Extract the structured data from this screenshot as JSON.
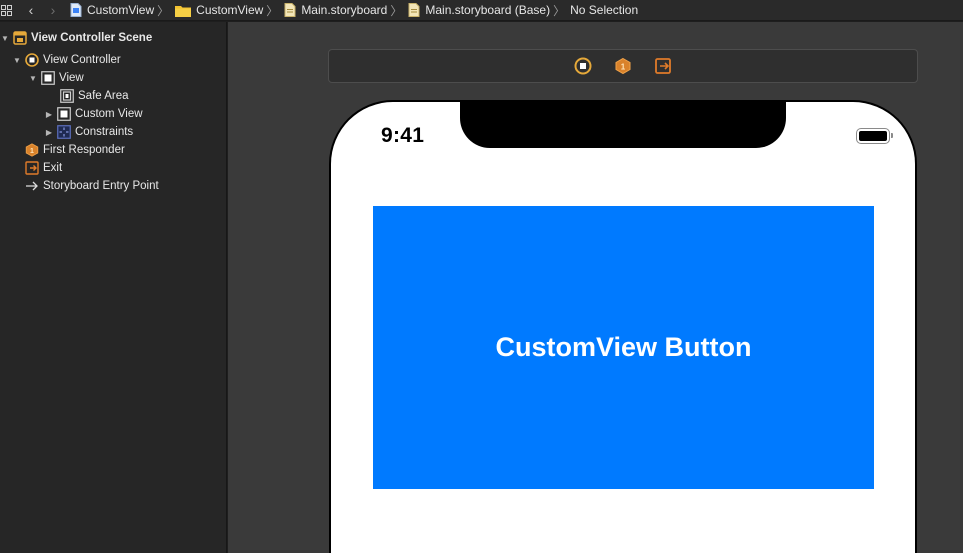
{
  "jumpbar": {
    "crumbs": [
      {
        "label": "CustomView",
        "icon": "xcode-project-icon"
      },
      {
        "label": "CustomView",
        "icon": "folder-icon"
      },
      {
        "label": "Main.storyboard",
        "icon": "storyboard-file-icon"
      },
      {
        "label": "Main.storyboard (Base)",
        "icon": "storyboard-file-icon"
      },
      {
        "label": "No Selection",
        "icon": ""
      }
    ]
  },
  "outline": {
    "items": [
      {
        "label": "View Controller Scene",
        "icon": "scene-icon",
        "expanded": true
      },
      {
        "label": "View Controller",
        "icon": "view-controller-icon",
        "expanded": true
      },
      {
        "label": "View",
        "icon": "view-icon",
        "expanded": true
      },
      {
        "label": "Safe Area",
        "icon": "safe-area-icon"
      },
      {
        "label": "Custom View",
        "icon": "view-icon",
        "expanded": false
      },
      {
        "label": "Constraints",
        "icon": "constraints-icon",
        "expanded": false
      },
      {
        "label": "First Responder",
        "icon": "first-responder-icon"
      },
      {
        "label": "Exit",
        "icon": "exit-icon"
      },
      {
        "label": "Storyboard Entry Point",
        "icon": "entry-arrow-icon"
      }
    ]
  },
  "canvas": {
    "scene_icons": [
      "view-controller-icon",
      "first-responder-icon",
      "exit-icon"
    ],
    "status_time": "9:41",
    "custom_view_label": "CustomView Button"
  },
  "colors": {
    "accent_blue": "#007aff",
    "vc_yellow": "#e6a93a",
    "first_responder_orange": "#d9822b"
  }
}
